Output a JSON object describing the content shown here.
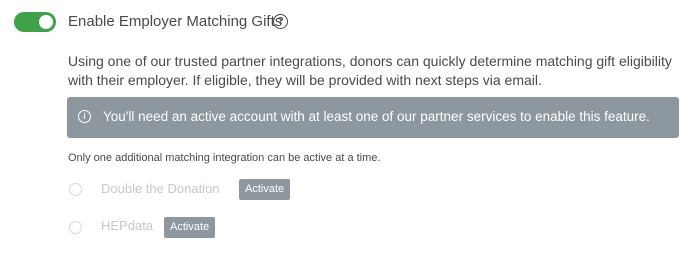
{
  "setting": {
    "enabled": true,
    "title": "Enable Employer Matching Gifts",
    "help_icon": "question-circle-icon",
    "description": "Using one of our trusted partner integrations, donors can quickly determine matching gift eligibility with their employer. If eligible, they will be provided with next steps via email."
  },
  "alert": {
    "icon": "info-circle-icon",
    "text": "You'll need an active account with at least one of our partner services to enable this feature."
  },
  "note": "Only one additional matching integration can be active at a time.",
  "integrations": [
    {
      "name": "Double the Donation",
      "button_label": "Activate",
      "selected": false
    },
    {
      "name": "HEPdata",
      "button_label": "Activate",
      "selected": false
    }
  ],
  "colors": {
    "toggle_on": "#3fa24a",
    "alert_background": "#8d979f",
    "button_background": "#8d979f",
    "text": "#4a4a4a",
    "disabled_text": "#c8c8c8"
  }
}
